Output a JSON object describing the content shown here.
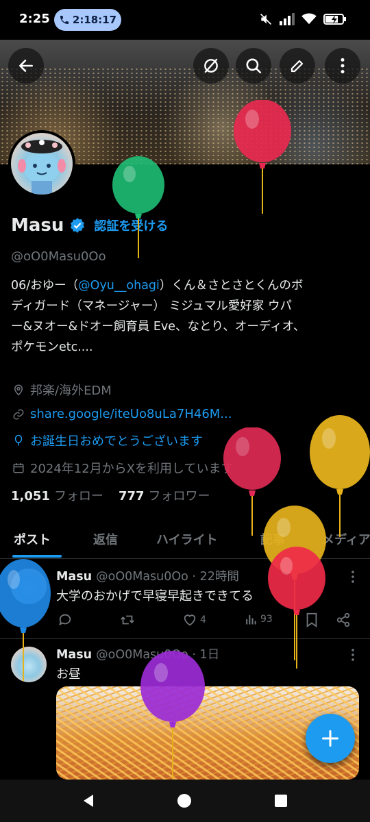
{
  "status_bar": {
    "time": "2:25",
    "call_timer": "2:18:17",
    "icons": [
      "mute-icon",
      "signal-icon",
      "wifi-icon",
      "battery-charging-icon"
    ]
  },
  "toolbar": {
    "back_icon": "back-arrow-icon",
    "grok_icon": "slash-circle-icon",
    "search_icon": "search-icon",
    "edit_icon": "pencil-icon",
    "more_icon": "more-vertical-icon"
  },
  "profile": {
    "name": "Masu",
    "verify_label": "認証を受ける",
    "handle": "@oO0Masu0Oo",
    "bio_prefix": "06/おゆー（",
    "bio_mention": "@Oyu__ohagi",
    "bio_rest_line1": "）くん＆さとさとくんのボ",
    "bio_line2": "ディガード（マネージャー） ミジュマル愛好家 ウパ",
    "bio_line3": "ー&ヌオー&ドオー飼育員 Eve、なとり、オーディオ、",
    "bio_line4": "ポケモンetc....",
    "location": "邦楽/海外EDM",
    "link": "share.google/iteUo8uLa7H46M...",
    "birthday": "お誕生日おめでとうございます",
    "joined": "2024年12月からXを利用しています",
    "following_count": "1,051",
    "following_label": "フォロー",
    "followers_count": "777",
    "followers_label": "フォロワー"
  },
  "tabs": [
    {
      "label": "ポスト",
      "active": true
    },
    {
      "label": "返信",
      "active": false
    },
    {
      "label": "ハイライト",
      "active": false
    },
    {
      "label": "記事",
      "active": false
    },
    {
      "label": "メディア",
      "active": false
    }
  ],
  "posts": [
    {
      "author": "Masu",
      "handle_time": "@oO0Masu0Oo · 22時間",
      "text": "大学のおかげで早寝早起きできてる",
      "likes": "4",
      "views": "93"
    },
    {
      "author": "Masu",
      "handle_time": "@oO0Masu0Oo · 1日",
      "text": "お昼"
    }
  ],
  "colors": {
    "accent": "#1d9bf0",
    "muted": "#71767b",
    "text": "#e7e9ea",
    "background": "#000000"
  },
  "balloons": [
    {
      "color": "#e8294f"
    },
    {
      "color": "#1fbf75"
    },
    {
      "color": "#e02a55"
    },
    {
      "color": "#e6b21c"
    },
    {
      "color": "#e6b21c"
    },
    {
      "color": "#ee2a48"
    },
    {
      "color": "#1e88e5"
    },
    {
      "color": "#9b2bd6"
    }
  ]
}
